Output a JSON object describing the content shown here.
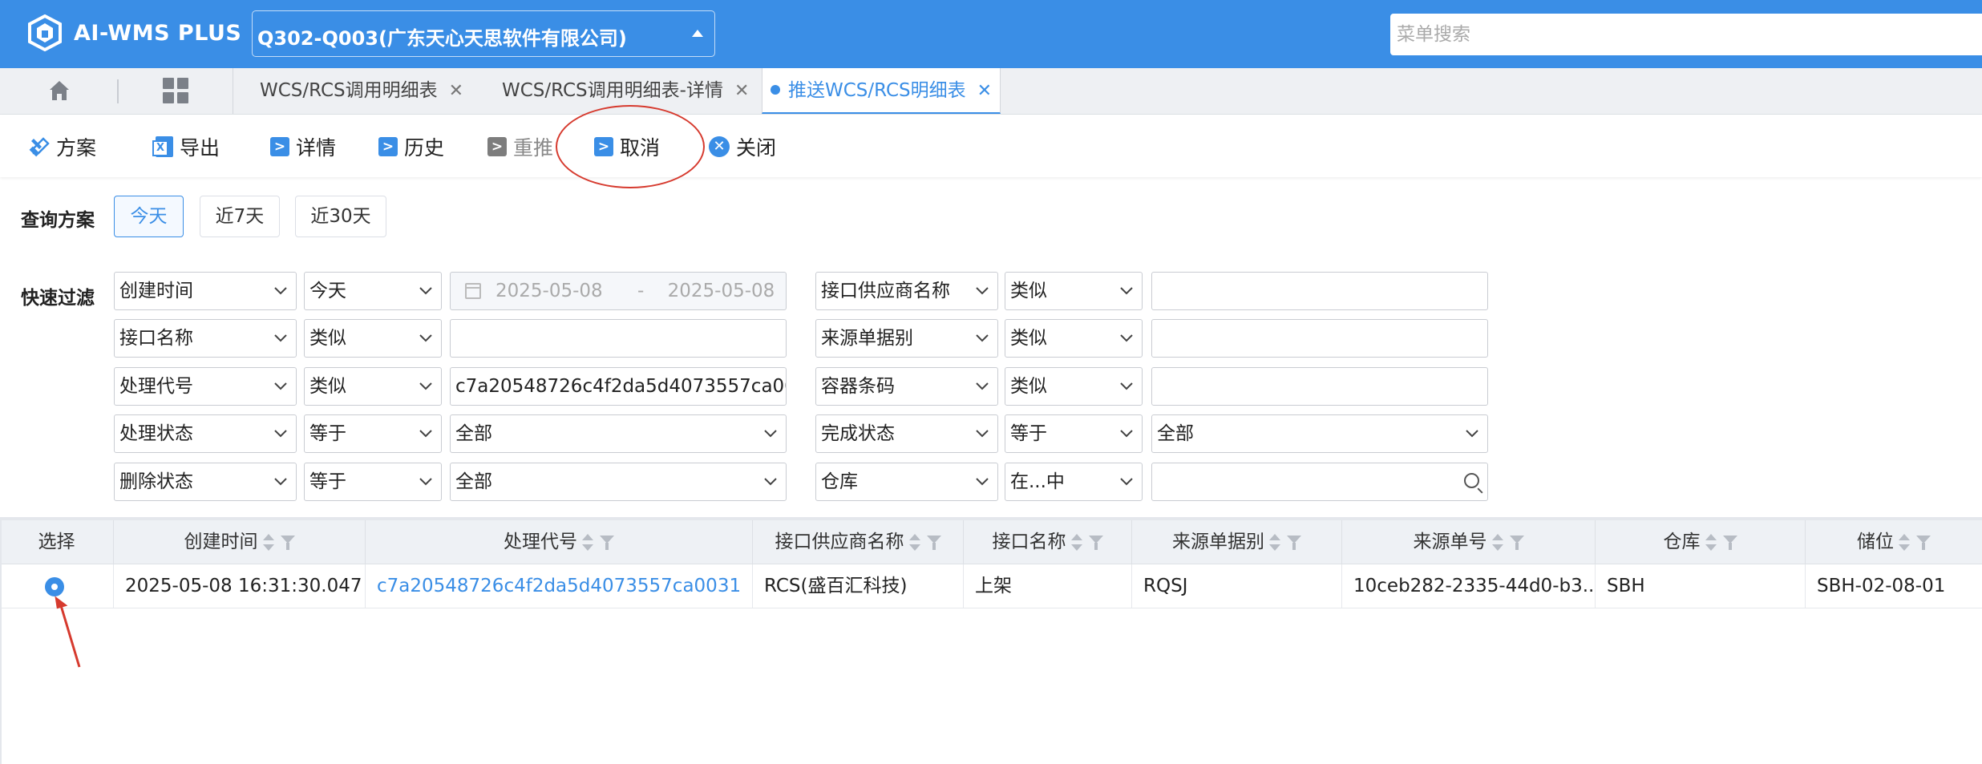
{
  "app": {
    "title": "AI-WMS PLUS"
  },
  "company": {
    "selected": "Q302-Q003(广东天心天思软件有限公司)"
  },
  "menu_search": {
    "placeholder": "菜单搜索"
  },
  "tabs": [
    {
      "label": "WCS/RCS调用明细表",
      "active": false
    },
    {
      "label": "WCS/RCS调用明细表-详情",
      "active": false
    },
    {
      "label": "推送WCS/RCS明细表",
      "active": true
    }
  ],
  "toolbar": {
    "scheme": "方案",
    "export": "导出",
    "detail": "详情",
    "history": "历史",
    "repush": "重推",
    "cancel": "取消",
    "close": "关闭"
  },
  "query": {
    "label": "查询方案",
    "options": [
      "今天",
      "近7天",
      "近30天"
    ],
    "active": "今天"
  },
  "filter": {
    "label": "快速过滤",
    "rows_left": [
      {
        "field": "创建时间",
        "op": "今天",
        "value": "",
        "date_from": "2025-05-08",
        "date_sep": "-",
        "date_to": "2025-05-08"
      },
      {
        "field": "接口名称",
        "op": "类似",
        "value": ""
      },
      {
        "field": "处理代号",
        "op": "类似",
        "value": "c7a20548726c4f2da5d4073557ca0031"
      },
      {
        "field": "处理状态",
        "op": "等于",
        "value": "全部"
      },
      {
        "field": "删除状态",
        "op": "等于",
        "value": "全部"
      }
    ],
    "rows_right": [
      {
        "field": "接口供应商名称",
        "op": "类似",
        "value": ""
      },
      {
        "field": "来源单据别",
        "op": "类似",
        "value": ""
      },
      {
        "field": "容器条码",
        "op": "类似",
        "value": ""
      },
      {
        "field": "完成状态",
        "op": "等于",
        "value": "全部"
      },
      {
        "field": "仓库",
        "op": "在...中",
        "value": ""
      }
    ]
  },
  "table": {
    "columns": [
      "选择",
      "创建时间",
      "处理代号",
      "接口供应商名称",
      "接口名称",
      "来源单据别",
      "来源单号",
      "仓库",
      "储位"
    ],
    "rows": [
      {
        "selected": true,
        "created": "2025-05-08 16:31:30.047",
        "code": "c7a20548726c4f2da5d4073557ca0031",
        "vendor": "RCS(盛百汇科技)",
        "api": "上架",
        "src_type": "RQSJ",
        "src_no": "10ceb282-2335-44d0-b3...",
        "warehouse": "SBH",
        "location": "SBH-02-08-01"
      }
    ]
  },
  "colors": {
    "primary": "#3a8ee6",
    "annotation": "#d63a2e"
  }
}
